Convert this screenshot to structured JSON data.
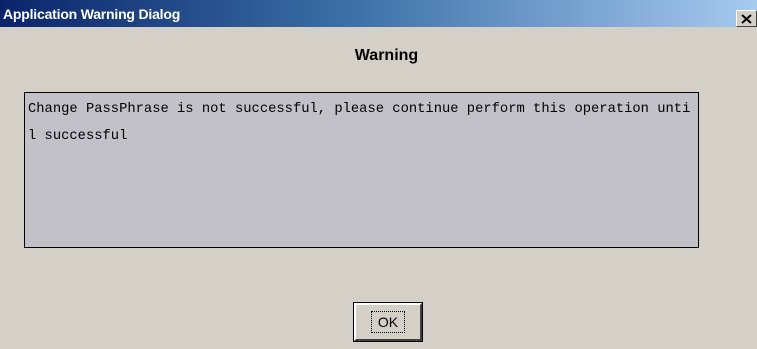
{
  "window": {
    "title": "Application Warning Dialog",
    "close_icon": "close-icon"
  },
  "dialog": {
    "heading": "Warning",
    "message": "Change PassPhrase is not successful, please continue perform this operation until successful",
    "ok_label": "OK"
  },
  "colors": {
    "titlebar_start": "#0a246a",
    "titlebar_end": "#a6caf0",
    "window_bg": "#d4d0c8",
    "message_bg": "#c3c1c8"
  }
}
